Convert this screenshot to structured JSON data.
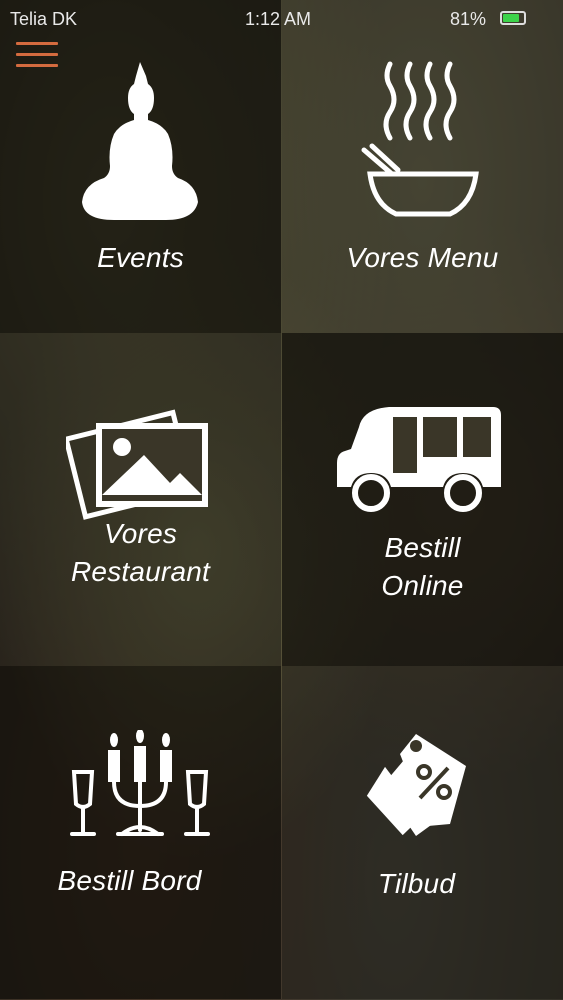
{
  "status_bar": {
    "carrier": "Telia DK",
    "time": "1:12 AM",
    "battery_percent": "81%",
    "battery_level": 0.81,
    "battery_color": "#3cd34a"
  },
  "menu_button": {
    "icon": "hamburger-menu-icon",
    "color": "#d46b3f"
  },
  "tiles": [
    {
      "label": "Events",
      "icon": "buddha-icon"
    },
    {
      "label": "Vores Menu",
      "icon": "noodle-bowl-icon"
    },
    {
      "label_line1": "Vores",
      "label_line2": "Restaurant",
      "icon": "photos-icon"
    },
    {
      "label_line1": "Bestill",
      "label_line2": "Online",
      "icon": "tuk-tuk-icon"
    },
    {
      "label": "Bestill Bord",
      "icon": "candles-glasses-icon"
    },
    {
      "label": "Tilbud",
      "icon": "discount-tag-icon"
    }
  ]
}
